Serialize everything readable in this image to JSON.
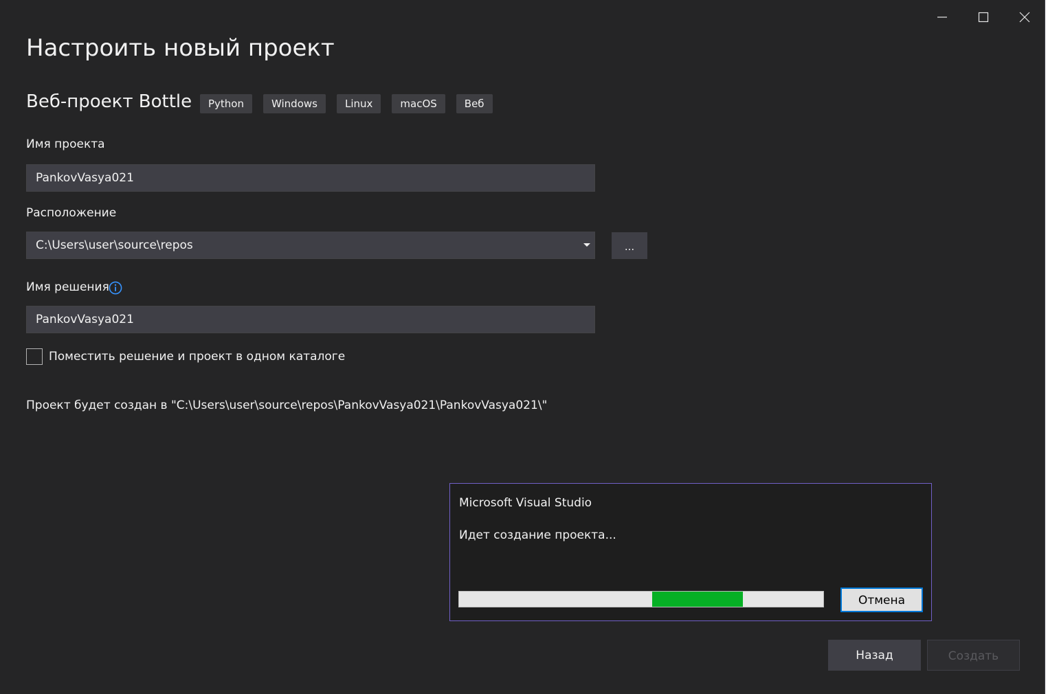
{
  "window_controls": {
    "minimize_icon": "minimize-icon",
    "maximize_icon": "maximize-icon",
    "close_icon": "close-icon"
  },
  "title": "Настроить новый проект",
  "template": {
    "name": "Веб-проект Bottle",
    "tags": [
      "Python",
      "Windows",
      "Linux",
      "macOS",
      "Веб"
    ]
  },
  "form": {
    "project_name_label": "Имя проекта",
    "project_name_value": "PankovVasya021",
    "location_label": "Расположение",
    "location_value": "C:\\Users\\user\\source\\repos",
    "browse_label": "...",
    "solution_name_label": "Имя решения",
    "solution_name_value": "PankovVasya021",
    "same_dir_label": "Поместить решение и проект в одном каталоге",
    "same_dir_checked": false,
    "path_note": "Проект будет создан в \"C:\\Users\\user\\source\\repos\\PankovVasya021\\PankovVasya021\\\""
  },
  "progress_dialog": {
    "title": "Microsoft Visual Studio",
    "message": "Идет создание проекта...",
    "progress_segment_start": 0.53,
    "progress_segment_end": 0.78,
    "cancel_label": "Отмена"
  },
  "footer": {
    "back_label": "Назад",
    "create_label": "Создать"
  },
  "colors": {
    "background": "#252526",
    "field": "#3f3f46",
    "dialog_border": "#7160c8",
    "progress_fill": "#06b025",
    "info_icon": "#3794ff"
  }
}
